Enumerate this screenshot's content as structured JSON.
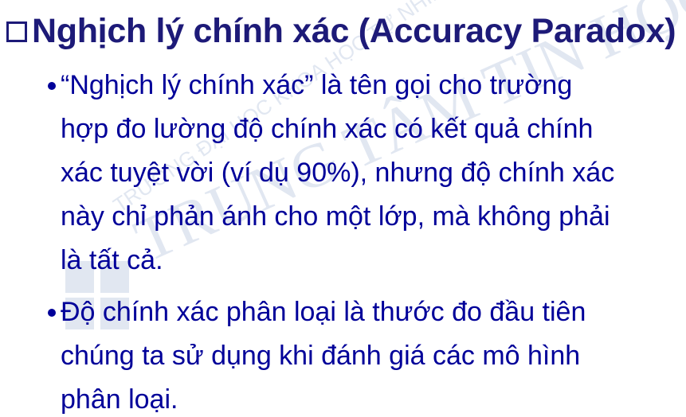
{
  "heading": {
    "icon": "square-bullet-icon",
    "text": "Nghịch lý chính xác (Accuracy Paradox)"
  },
  "bullets": [
    {
      "lines": [
        "“Nghịch lý chính xác” là tên gọi cho trường",
        "hợp đo lường độ chính xác có kết quả chính",
        "xác tuyệt vời (ví dụ 90%), nhưng độ chính xác",
        "này chỉ phản ánh cho một lớp, mà không phải",
        "là tất cả."
      ]
    },
    {
      "lines": [
        "Độ chính xác phân loại là thước đo đầu tiên",
        "chúng ta sử dụng khi đánh giá các mô hình",
        "phân loại."
      ]
    }
  ],
  "watermark": {
    "arc_text": "TRƯỜNG ĐẠI HỌC KHOA HỌC TỰ NHIÊN",
    "main_text": "TRUNG TÂM TIN HỌC"
  },
  "colors": {
    "heading": "#1d1a78",
    "body": "#000099",
    "watermark": "#c9d3e6"
  }
}
